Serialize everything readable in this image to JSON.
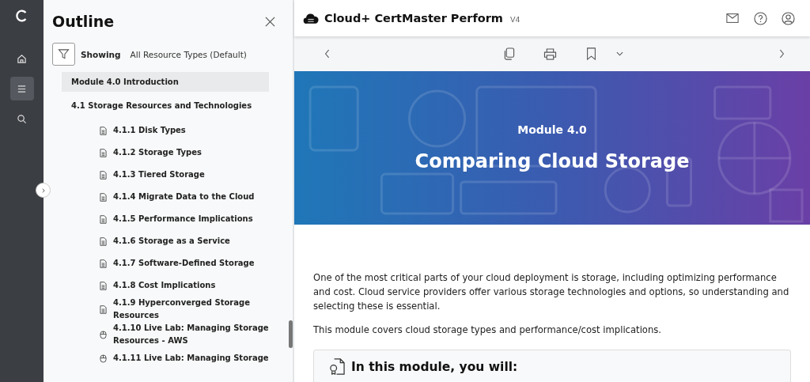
{
  "rail": {
    "items": [
      {
        "kind": "home",
        "selected": false
      },
      {
        "kind": "outline",
        "selected": true
      },
      {
        "kind": "search",
        "selected": false
      }
    ]
  },
  "outline": {
    "title": "Outline",
    "filter": {
      "label": "Showing",
      "value": "All Resource Types (Default)"
    },
    "items": [
      {
        "label": "Module 4.0 Introduction",
        "selected": true
      },
      {
        "label": "4.1 Storage Resources and Technologies",
        "selected": false,
        "children": [
          {
            "kind": "page",
            "label": "4.1.1 Disk Types"
          },
          {
            "kind": "page",
            "label": "4.1.2 Storage Types"
          },
          {
            "kind": "page",
            "label": "4.1.3 Tiered Storage"
          },
          {
            "kind": "page",
            "label": "4.1.4 Migrate Data to the Cloud"
          },
          {
            "kind": "page",
            "label": "4.1.5 Performance Implications"
          },
          {
            "kind": "page",
            "label": "4.1.6 Storage as a Service"
          },
          {
            "kind": "page",
            "label": "4.1.7 Software-Defined Storage"
          },
          {
            "kind": "page",
            "label": "4.1.8 Cost Implications"
          },
          {
            "kind": "page",
            "label": "4.1.9 Hyperconverged Storage Resources"
          },
          {
            "kind": "lab",
            "label": "4.1.10 Live Lab: Managing Storage Resources - AWS"
          },
          {
            "kind": "lab",
            "label": "4.1.11 Live Lab: Managing Storage"
          }
        ]
      }
    ]
  },
  "header": {
    "title": "Cloud+ CertMaster Perform",
    "version": "V4"
  },
  "banner": {
    "subtitle": "Module 4.0",
    "title": "Comparing Cloud Storage"
  },
  "content": {
    "paragraphs": [
      "One of the most critical parts of your cloud deployment is storage, including optimizing performance and cost. Cloud service providers offer various storage technologies and options, so understanding and selecting these is essential.",
      "This module covers cloud storage types and performance/cost implications."
    ],
    "callout": {
      "title": "In this module, you will:"
    }
  }
}
